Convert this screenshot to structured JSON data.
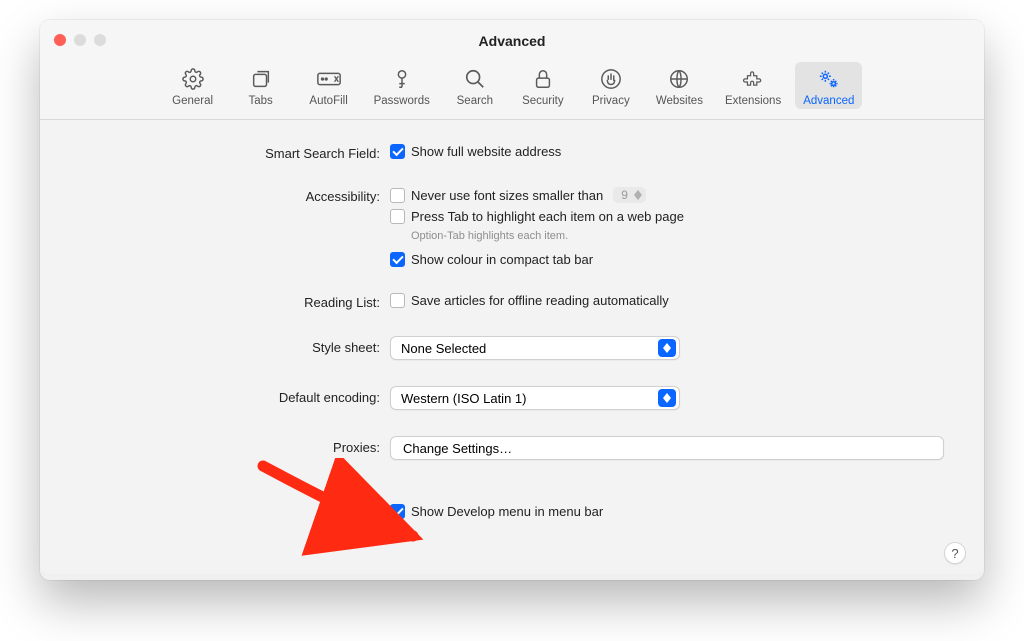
{
  "window_title": "Advanced",
  "tabs": [
    {
      "id": "general",
      "label": "General"
    },
    {
      "id": "tabs",
      "label": "Tabs"
    },
    {
      "id": "autofill",
      "label": "AutoFill"
    },
    {
      "id": "passwords",
      "label": "Passwords"
    },
    {
      "id": "search",
      "label": "Search"
    },
    {
      "id": "security",
      "label": "Security"
    },
    {
      "id": "privacy",
      "label": "Privacy"
    },
    {
      "id": "websites",
      "label": "Websites"
    },
    {
      "id": "extensions",
      "label": "Extensions"
    },
    {
      "id": "advanced",
      "label": "Advanced"
    }
  ],
  "active_tab": "advanced",
  "labels": {
    "smart_search": "Smart Search Field:",
    "accessibility": "Accessibility:",
    "reading_list": "Reading List:",
    "style_sheet": "Style sheet:",
    "default_encoding": "Default encoding:",
    "proxies": "Proxies:"
  },
  "options": {
    "show_full_address": "Show full website address",
    "never_font_sizes": "Never use font sizes smaller than",
    "font_size_value": "9",
    "press_tab": "Press Tab to highlight each item on a web page",
    "tab_hint": "Option-Tab highlights each item.",
    "show_colour_tab": "Show colour in compact tab bar",
    "save_offline": "Save articles for offline reading automatically",
    "style_sheet_value": "None Selected",
    "encoding_value": "Western (ISO Latin 1)",
    "change_settings": "Change Settings…",
    "show_develop": "Show Develop menu in menu bar"
  },
  "checked": {
    "show_full_address": true,
    "never_font_sizes": false,
    "press_tab": false,
    "show_colour_tab": true,
    "save_offline": false,
    "show_develop": true
  },
  "help_label": "?",
  "colors": {
    "accent": "#0a66ff",
    "close_button": "#ff5f57"
  }
}
